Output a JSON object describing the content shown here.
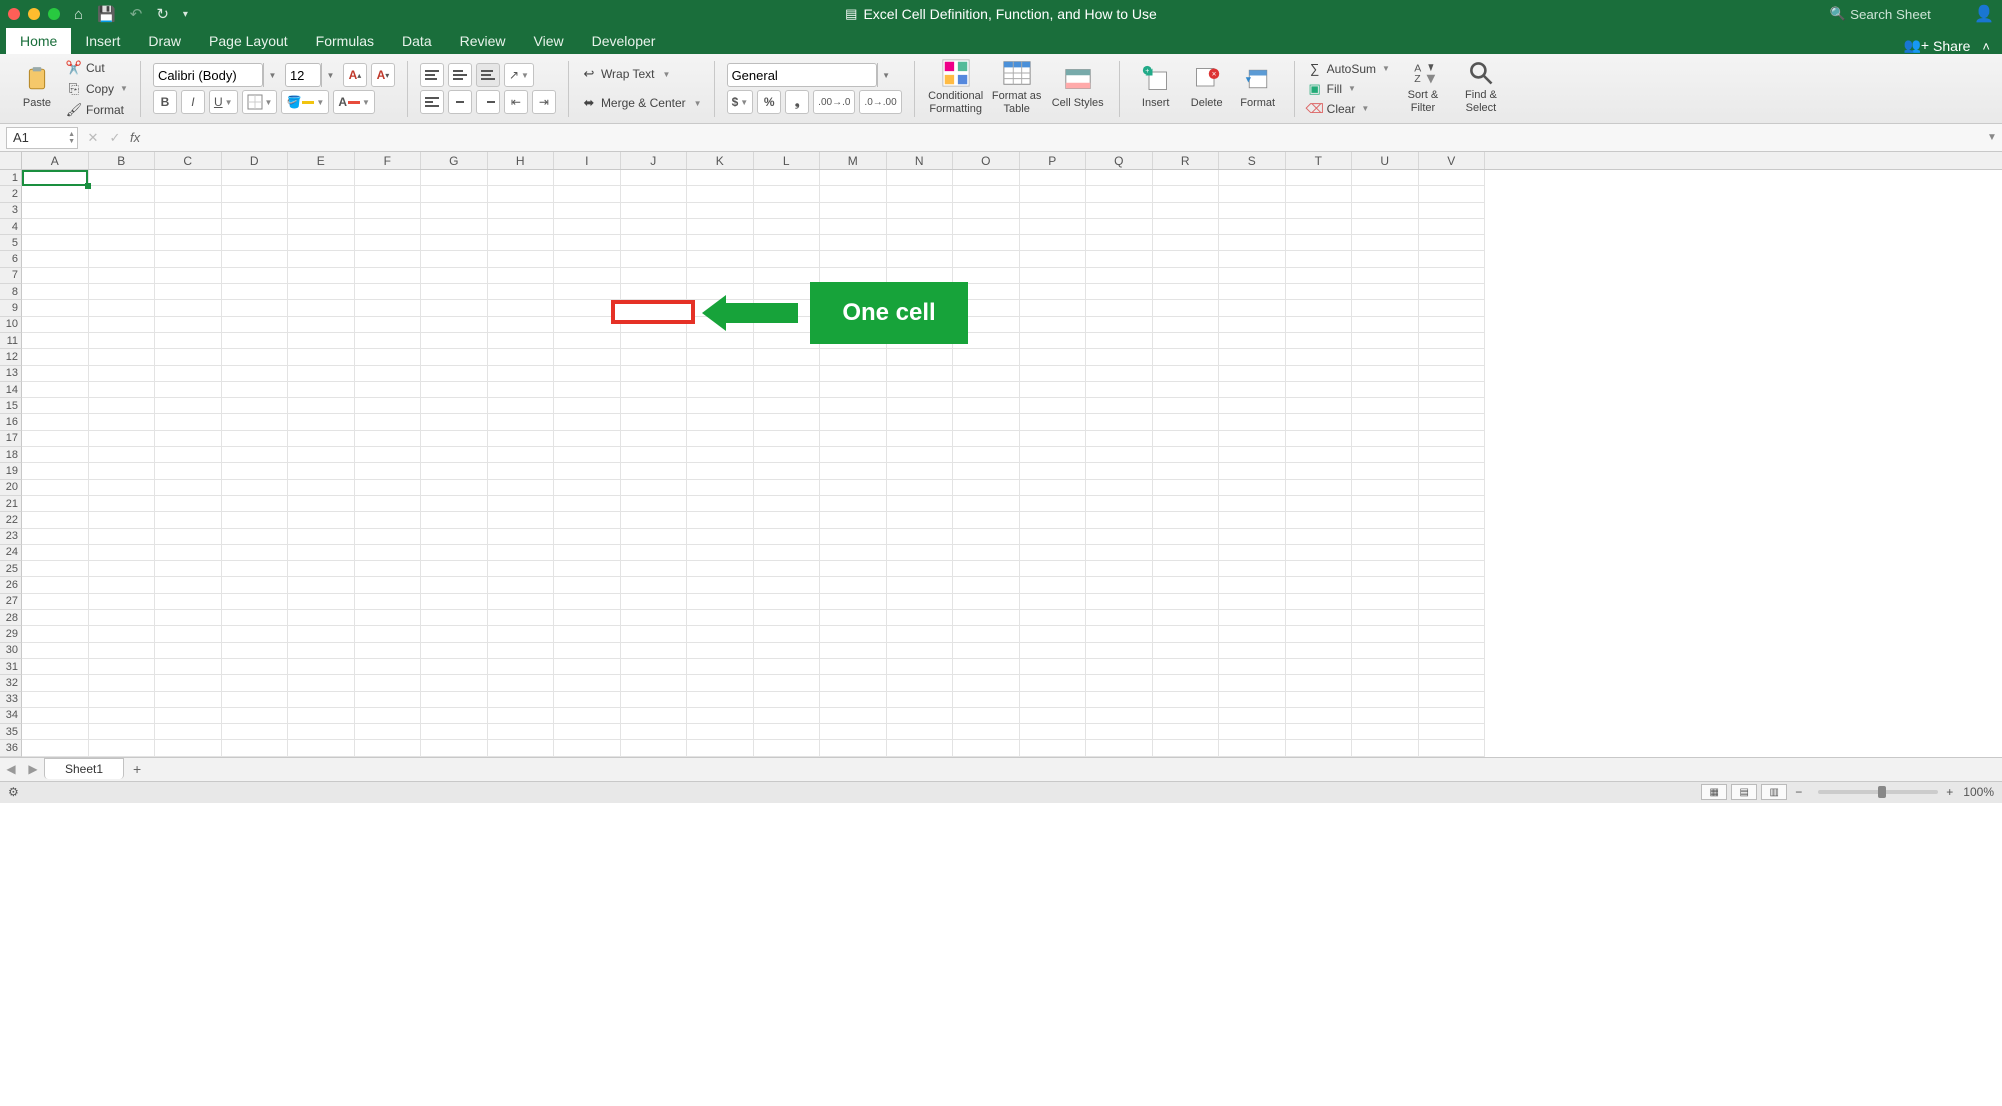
{
  "titlebar": {
    "title": "Excel Cell Definition, Function, and How to Use",
    "search_placeholder": "Search Sheet"
  },
  "tabs": {
    "items": [
      "Home",
      "Insert",
      "Draw",
      "Page Layout",
      "Formulas",
      "Data",
      "Review",
      "View",
      "Developer"
    ],
    "active_index": 0,
    "share_label": "Share"
  },
  "ribbon": {
    "clipboard": {
      "paste": "Paste",
      "cut": "Cut",
      "copy": "Copy",
      "format": "Format"
    },
    "font": {
      "name": "Calibri (Body)",
      "size": "12"
    },
    "alignment": {
      "wrap": "Wrap Text",
      "merge": "Merge & Center"
    },
    "number": {
      "format": "General"
    },
    "styles": {
      "cond": "Conditional Formatting",
      "table": "Format as Table",
      "cell": "Cell Styles"
    },
    "cells": {
      "insert": "Insert",
      "delete": "Delete",
      "format": "Format"
    },
    "editing": {
      "autosum": "AutoSum",
      "fill": "Fill",
      "clear": "Clear",
      "sort": "Sort & Filter",
      "find": "Find & Select"
    }
  },
  "formula_bar": {
    "name_box": "A1",
    "formula": ""
  },
  "grid": {
    "cols": [
      "A",
      "B",
      "C",
      "D",
      "E",
      "F",
      "G",
      "H",
      "I",
      "J",
      "K",
      "L",
      "M",
      "N",
      "O",
      "P",
      "Q",
      "R",
      "S",
      "T",
      "U",
      "V"
    ],
    "row_count": 36,
    "selected_cell": "A1"
  },
  "annotation": {
    "label": "One cell"
  },
  "sheetbar": {
    "sheet_name": "Sheet1"
  },
  "statusbar": {
    "zoom": "100%"
  }
}
